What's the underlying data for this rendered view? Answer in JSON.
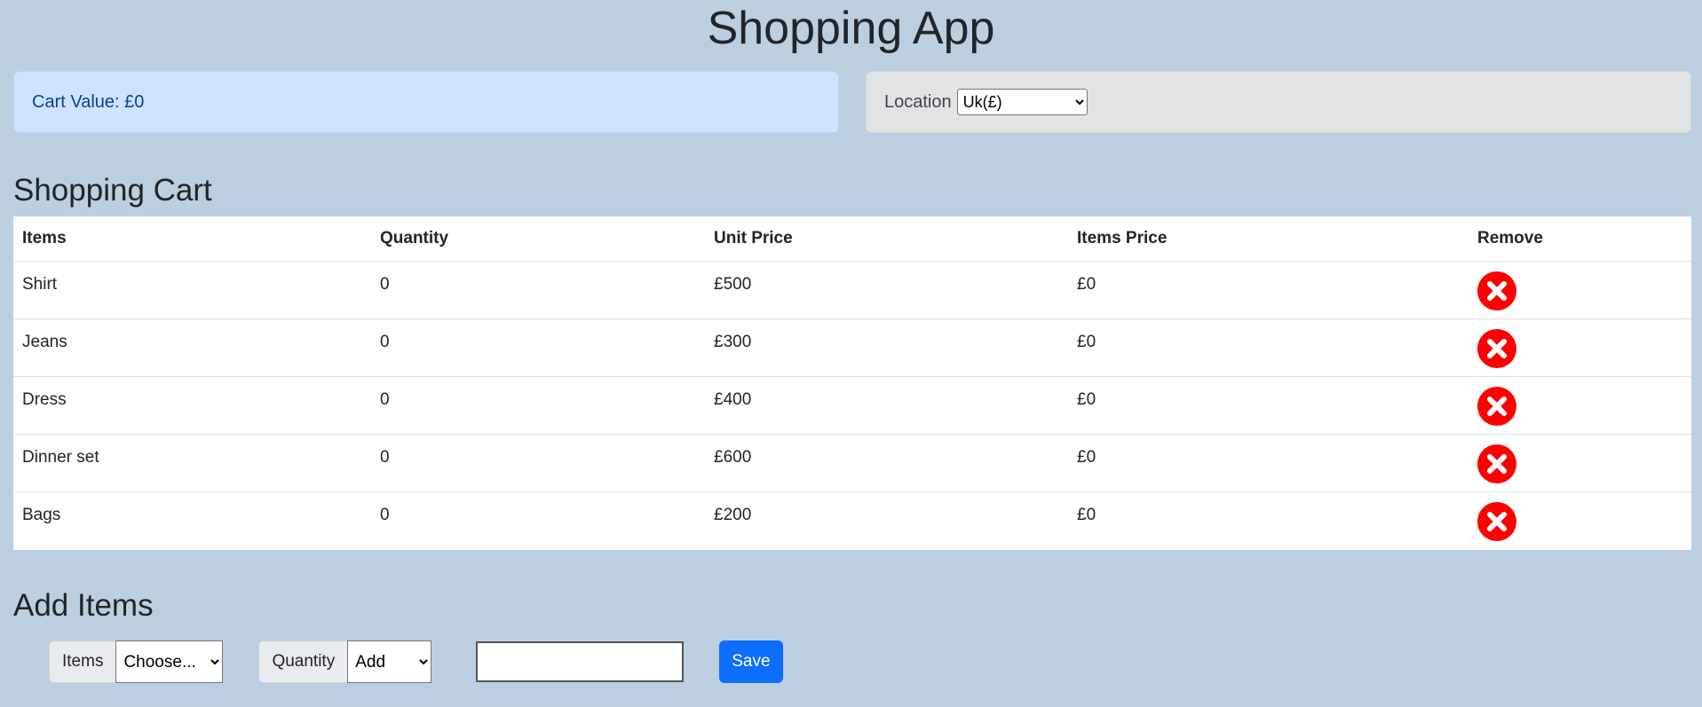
{
  "app": {
    "title": "Shopping App"
  },
  "cart_value": {
    "label": "Cart Value: £0"
  },
  "location": {
    "label": "Location",
    "selected": "Uk(£)"
  },
  "cart": {
    "title": "Shopping Cart",
    "headers": {
      "items": "Items",
      "quantity": "Quantity",
      "unit_price": "Unit Price",
      "items_price": "Items Price",
      "remove": "Remove"
    },
    "rows": [
      {
        "item": "Shirt",
        "quantity": "0",
        "unit_price": "£500",
        "items_price": "£0"
      },
      {
        "item": "Jeans",
        "quantity": "0",
        "unit_price": "£300",
        "items_price": "£0"
      },
      {
        "item": "Dress",
        "quantity": "0",
        "unit_price": "£400",
        "items_price": "£0"
      },
      {
        "item": "Dinner set",
        "quantity": "0",
        "unit_price": "£600",
        "items_price": "£0"
      },
      {
        "item": "Bags",
        "quantity": "0",
        "unit_price": "£200",
        "items_price": "£0"
      }
    ],
    "remove_icon": "close-circle-icon",
    "remove_color": "#ff0000"
  },
  "add_items": {
    "title": "Add Items",
    "items_label": "Items",
    "items_selected": "Choose...",
    "quantity_label": "Quantity",
    "quantity_selected": "Add",
    "quantity_value": "",
    "save_label": "Save"
  },
  "colors": {
    "background": "#bbcfe0",
    "primary": "#0d6efd",
    "info_alert": "#cfe2ff",
    "secondary_alert": "#e2e3e5"
  }
}
